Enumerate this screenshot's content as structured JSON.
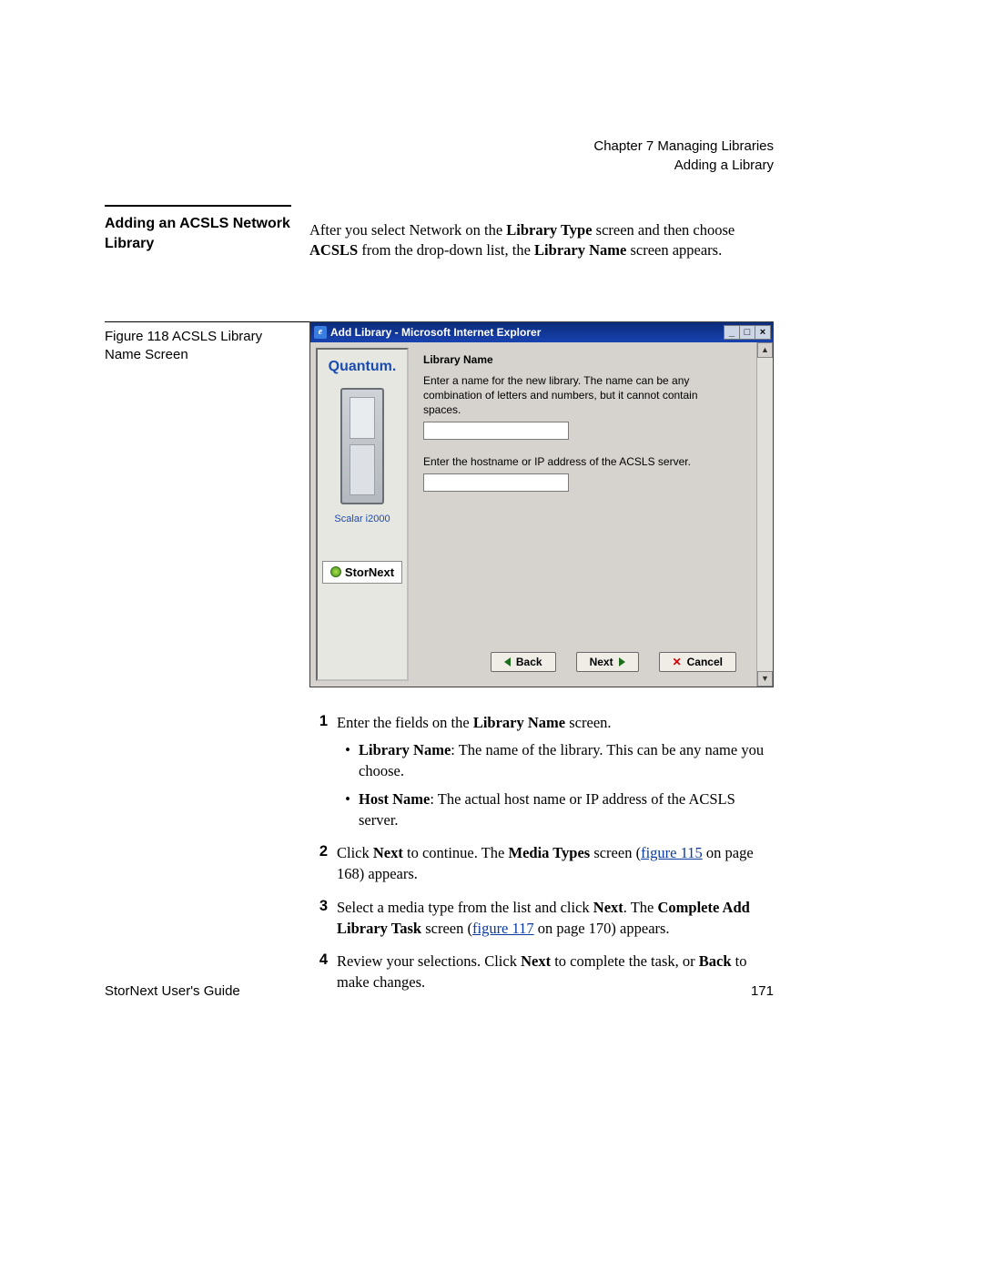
{
  "header": {
    "chapter": "Chapter 7  Managing Libraries",
    "section": "Adding a Library"
  },
  "section_heading": "Adding an ACSLS Network Library",
  "intro": {
    "t1": "After you select Network on the ",
    "b1": "Library Type",
    "t2": " screen and then choose ",
    "b2": "ACSLS",
    "t3": " from the drop-down list, the ",
    "b3": "Library Name",
    "t4": " screen appears."
  },
  "figure_caption": "Figure 118  ACSLS Library Name Screen",
  "screenshot": {
    "window_title": "Add Library - Microsoft Internet Explorer",
    "sidebar": {
      "brand": "Quantum.",
      "model": "Scalar i2000",
      "product": "StorNext"
    },
    "form": {
      "title": "Library Name",
      "desc1": "Enter a name for the new library. The name can be any combination of letters and numbers, but it cannot contain spaces.",
      "desc2": "Enter the hostname or IP address of the ACSLS server."
    },
    "buttons": {
      "back": "Back",
      "next": "Next",
      "cancel": "Cancel"
    }
  },
  "steps": {
    "s1": {
      "intro_a": "Enter the fields on the ",
      "intro_b": "Library Name",
      "intro_c": " screen.",
      "bul1_b": "Library Name",
      "bul1_t": ": The name of the library. This can be any name you choose.",
      "bul2_b": "Host Name",
      "bul2_t": ": The actual host name or IP address of the ACSLS server."
    },
    "s2": {
      "a": "Click ",
      "b1": "Next",
      "c": " to continue. The ",
      "b2": "Media Types",
      "d": " screen (",
      "link": "figure 115",
      "e": " on page 168) appears."
    },
    "s3": {
      "a": "Select a media type from the list and click ",
      "b1": "Next",
      "c": ". The ",
      "b2": "Complete Add Library Task",
      "d": " screen (",
      "link": "figure 117",
      "e": " on page 170) appears."
    },
    "s4": {
      "a": "Review your selections. Click ",
      "b1": "Next",
      "c": " to complete the task, or ",
      "b2": "Back",
      "d": " to make changes."
    }
  },
  "footer": {
    "left": "StorNext User's Guide",
    "right": "171"
  }
}
